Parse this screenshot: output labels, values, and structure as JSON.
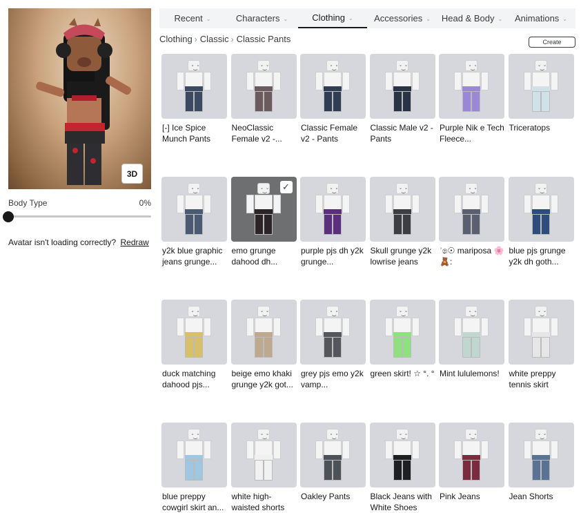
{
  "left_panel": {
    "btn_3d": "3D",
    "body_type_label": "Body Type",
    "body_type_value": "0%",
    "body_type_level": 0,
    "loading_text": "Avatar isn't loading correctly?",
    "redraw_link": "Redraw"
  },
  "tabs": [
    {
      "label": "Recent",
      "active": false
    },
    {
      "label": "Characters",
      "active": false
    },
    {
      "label": "Clothing",
      "active": true
    },
    {
      "label": "Accessories",
      "active": false
    },
    {
      "label": "Head & Body",
      "active": false
    },
    {
      "label": "Animations",
      "active": false
    }
  ],
  "breadcrumb": [
    "Clothing",
    "Classic",
    "Classic Pants"
  ],
  "create_label": "Create",
  "items": [
    {
      "name": "[-] Ice Spice Munch Pants",
      "color": "#3b4a63",
      "selected": false
    },
    {
      "name": "NeoClassic Female v2 -...",
      "color": "#6b5a5e",
      "selected": false
    },
    {
      "name": "Classic Female v2 - Pants",
      "color": "#2f3e55",
      "selected": false
    },
    {
      "name": "Classic Male v2 - Pants",
      "color": "#2a3245",
      "selected": false
    },
    {
      "name": "Purple Nik e Tech Fleece...",
      "color": "#9a87d6",
      "selected": false
    },
    {
      "name": "Triceratops",
      "color": "#cfe3e6",
      "selected": false
    },
    {
      "name": "y2k blue graphic jeans grunge...",
      "color": "#4a5a72",
      "selected": false
    },
    {
      "name": "emo grunge dahood dh...",
      "color": "#2a2426",
      "selected": true
    },
    {
      "name": "purple pjs dh y2k grunge...",
      "color": "#5b2f7e",
      "selected": false
    },
    {
      "name": "Skull grunge y2k lowrise jeans",
      "color": "#3c3e44",
      "selected": false
    },
    {
      "name": "ʾ෧☉ mariposa 🌸🧸:",
      "color": "#5a6070",
      "selected": false
    },
    {
      "name": "blue pjs grunge y2k dh goth...",
      "color": "#2f4d7a",
      "selected": false
    },
    {
      "name": "duck matching dahood pjs...",
      "color": "#d8c06a",
      "selected": false
    },
    {
      "name": "beige emo khaki grunge y2k got...",
      "color": "#bfa98e",
      "selected": false
    },
    {
      "name": "grey pjs emo y2k vamp...",
      "color": "#55565c",
      "selected": false
    },
    {
      "name": "green skirt! ☆ °. °",
      "color": "#8fe07f",
      "selected": false
    },
    {
      "name": "Mint lululemons!",
      "color": "#bfd7cf",
      "selected": false
    },
    {
      "name": "white preppy tennis skirt",
      "color": "#e6e6e6",
      "selected": false
    },
    {
      "name": "blue preppy cowgirl skirt an...",
      "color": "#9fc7e2",
      "selected": false
    },
    {
      "name": "white high-waisted shorts",
      "color": "#f1f1f1",
      "selected": false
    },
    {
      "name": "Oakley Pants",
      "color": "#4d5258",
      "selected": false
    },
    {
      "name": "Black Jeans with White Shoes",
      "color": "#1e1f22",
      "selected": false
    },
    {
      "name": "Pink Jeans",
      "color": "#7a2c3e",
      "selected": false
    },
    {
      "name": "Jean Shorts",
      "color": "#5a7294",
      "selected": false
    }
  ]
}
